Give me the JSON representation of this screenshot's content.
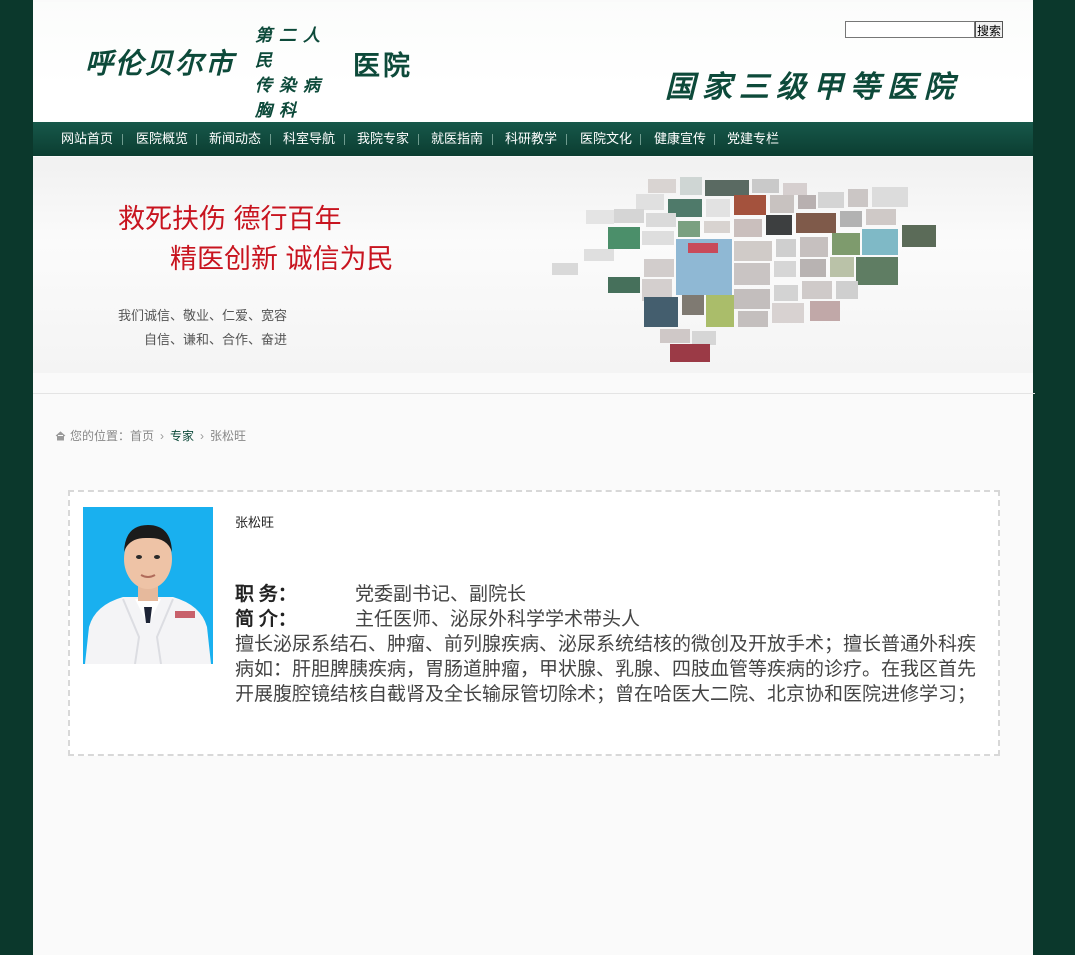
{
  "header": {
    "logo_city": "呼伦贝尔市",
    "logo_mid_lines": [
      "第二人民",
      "传染病",
      "胸科"
    ],
    "logo_hospital": "医院",
    "grade_slogan": "国家三级甲等医院",
    "search": {
      "placeholder": "",
      "value": "",
      "button_label": "搜索"
    }
  },
  "nav": {
    "items": [
      "网站首页",
      "医院概览",
      "新闻动态",
      "科室导航",
      "我院专家",
      "就医指南",
      "科研教学",
      "医院文化",
      "健康宣传",
      "党建专栏"
    ]
  },
  "banner": {
    "line1": "救死扶伤  德行百年",
    "line2": "精医创新  诚信为民",
    "values1": "我们诚信、敬业、仁爱、宽容",
    "values2": "自信、谦和、合作、奋进"
  },
  "breadcrumb": {
    "prefix": "您的位置：",
    "home": "首页",
    "category": "专家",
    "current": "张松旺"
  },
  "doctor": {
    "name": "张松旺",
    "position_label": "职        务：",
    "position": "党委副书记、副院长",
    "intro_label": "简        介：",
    "intro": "主任医师、泌尿外科学学术带头人",
    "description": "擅长泌尿系结石、肿瘤、前列腺疾病、泌尿系统结核的微创及开放手术；擅长普通外科疾病如：肝胆脾胰疾病，胃肠道肿瘤，甲状腺、乳腺、四肢血管等疾病的诊疗。在我区首先开展腹腔镜结核自截肾及全长输尿管切除术；曾在哈医大二院、北京协和医院进修学习；"
  },
  "colors": {
    "side_bg": "#0b382c",
    "nav_bg": "#17584a",
    "slogan_red": "#c8141f",
    "brand_green": "#0d4a3a"
  }
}
